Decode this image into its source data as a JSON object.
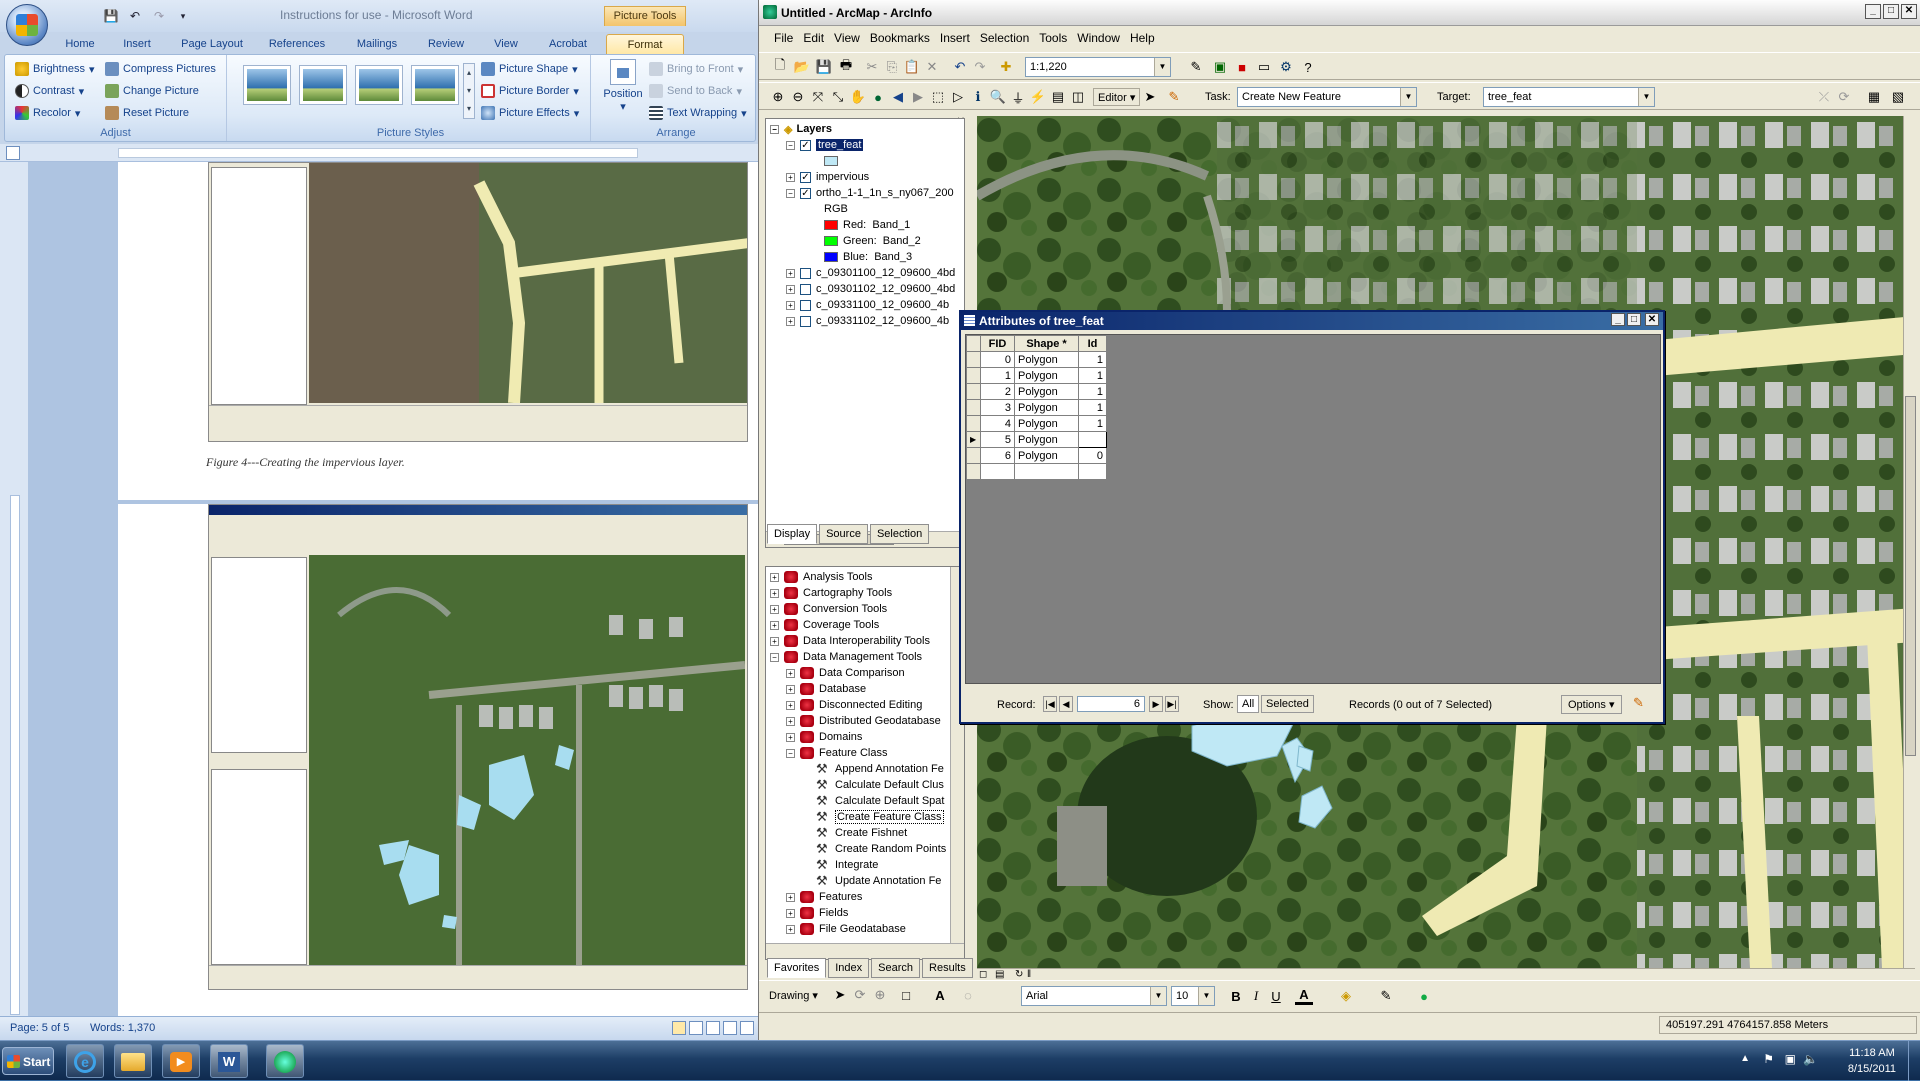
{
  "word": {
    "window_title": "Instructions for use - Microsoft Word",
    "context_tab_group": "Picture Tools",
    "tabs": [
      "Home",
      "Insert",
      "Page Layout",
      "References",
      "Mailings",
      "Review",
      "View",
      "Acrobat",
      "Format"
    ],
    "active_tab": "Format",
    "adjust": {
      "brightness": "Brightness",
      "contrast": "Contrast",
      "recolor": "Recolor",
      "compress": "Compress Pictures",
      "change": "Change Picture",
      "reset": "Reset Picture",
      "label": "Adjust"
    },
    "picture_styles": {
      "shape": "Picture Shape",
      "border": "Picture Border",
      "effects": "Picture Effects",
      "label": "Picture Styles"
    },
    "arrange": {
      "position": "Position",
      "bring_front": "Bring to Front",
      "send_back": "Send to Back",
      "text_wrapping": "Text Wrapping",
      "label": "Arrange"
    },
    "figure_caption": "Figure 4---Creating the impervious layer.",
    "status": {
      "page": "Page: 5 of 5",
      "words": "Words: 1,370"
    }
  },
  "arcmap": {
    "window_title": "Untitled - ArcMap - ArcInfo",
    "menu": [
      "File",
      "Edit",
      "View",
      "Bookmarks",
      "Insert",
      "Selection",
      "Tools",
      "Window",
      "Help"
    ],
    "scale": "1:1,220",
    "editor_label": "Editor",
    "task_label": "Task:",
    "task_value": "Create New Feature",
    "target_label": "Target:",
    "target_value": "tree_feat",
    "toc": {
      "root": "Layers",
      "layers": [
        {
          "name": "tree_feat",
          "checked": true,
          "selected": true
        },
        {
          "name": "impervious",
          "checked": true
        },
        {
          "name": "ortho_1-1_1n_s_ny067_200",
          "checked": true
        }
      ],
      "rgb_label": "RGB",
      "bands": [
        {
          "label": "Red:",
          "band": "Band_1",
          "color": "#ff0000"
        },
        {
          "label": "Green:",
          "band": "Band_2",
          "color": "#00ff00"
        },
        {
          "label": "Blue:",
          "band": "Band_3",
          "color": "#0000ff"
        }
      ],
      "other_layers": [
        "c_09301100_12_09600_4bd",
        "c_09301102_12_09600_4bd",
        "c_09331100_12_09600_4b",
        "c_09331102_12_09600_4b"
      ],
      "tabs": [
        "Display",
        "Source",
        "Selection"
      ]
    },
    "toolbox": {
      "items": [
        "Analysis Tools",
        "Cartography Tools",
        "Conversion Tools",
        "Coverage Tools",
        "Data Interoperability Tools",
        "Data Management Tools"
      ],
      "dm_children": [
        "Data Comparison",
        "Database",
        "Disconnected Editing",
        "Distributed Geodatabase",
        "Domains",
        "Feature Class"
      ],
      "fc_tools": [
        "Append Annotation Fe",
        "Calculate Default Clus",
        "Calculate Default Spat",
        "Create Feature Class",
        "Create Fishnet",
        "Create Random Points",
        "Integrate",
        "Update Annotation Fe"
      ],
      "after": [
        "Features",
        "Fields",
        "File Geodatabase"
      ],
      "tabs": [
        "Favorites",
        "Index",
        "Search",
        "Results"
      ]
    },
    "attributes": {
      "title": "Attributes of tree_feat",
      "columns": [
        "FID",
        "Shape *",
        "Id"
      ],
      "rows": [
        {
          "fid": "0",
          "shape": "Polygon",
          "id": "1"
        },
        {
          "fid": "1",
          "shape": "Polygon",
          "id": "1"
        },
        {
          "fid": "2",
          "shape": "Polygon",
          "id": "1"
        },
        {
          "fid": "3",
          "shape": "Polygon",
          "id": "1"
        },
        {
          "fid": "4",
          "shape": "Polygon",
          "id": "1"
        },
        {
          "fid": "5",
          "shape": "Polygon",
          "id": ""
        },
        {
          "fid": "6",
          "shape": "Polygon",
          "id": "0"
        }
      ],
      "record_label": "Record:",
      "record_value": "6",
      "show_label": "Show:",
      "all": "All",
      "selected": "Selected",
      "records_text": "Records (0 out of 7 Selected)",
      "options": "Options"
    },
    "drawing": {
      "label": "Drawing",
      "font": "Arial",
      "size": "10"
    },
    "status_coords": "405197.291  4764157.858 Meters"
  },
  "taskbar": {
    "start": "Start",
    "time": "11:18 AM",
    "date": "8/15/2011"
  }
}
